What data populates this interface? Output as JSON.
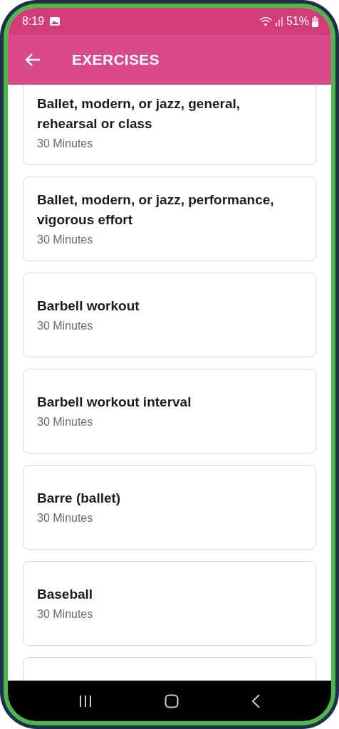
{
  "status_bar": {
    "time": "8:19",
    "battery": "51%"
  },
  "app_bar": {
    "title": "EXERCISES"
  },
  "exercises": [
    {
      "name": "Ballet, modern, or jazz, general, rehearsal or class",
      "duration": "30 Minutes"
    },
    {
      "name": "Ballet, modern, or jazz, performance, vigorous effort",
      "duration": "30 Minutes"
    },
    {
      "name": "Barbell workout",
      "duration": "30 Minutes"
    },
    {
      "name": "Barbell workout interval",
      "duration": "30 Minutes"
    },
    {
      "name": "Barre (ballet)",
      "duration": "30 Minutes"
    },
    {
      "name": "Baseball",
      "duration": "30 Minutes"
    }
  ]
}
